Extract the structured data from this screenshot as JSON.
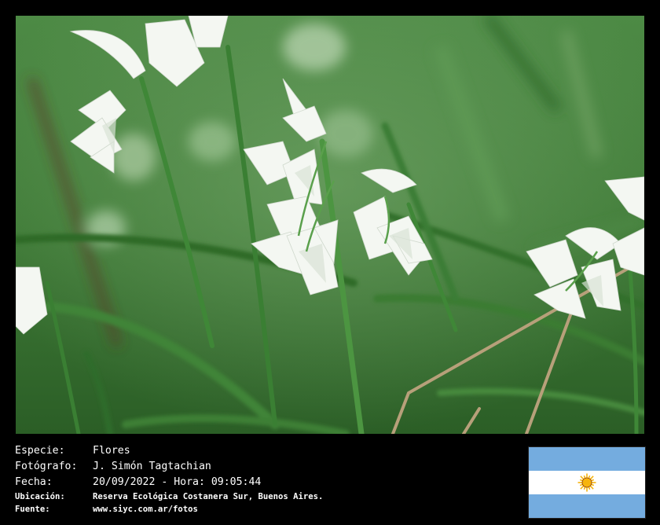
{
  "caption": {
    "especie_label": "Especie:",
    "especie_value": "Flores",
    "fotografo_label": "Fotógrafo:",
    "fotografo_value": "J. Simón Tagtachian",
    "fecha_label": "Fecha:",
    "fecha_value": "20/09/2022 - Hora: 09:05:44",
    "ubicacion_label": "Ubicación:",
    "ubicacion_value": "Reserva Ecológica Costanera Sur, Buenos Aires.",
    "fuente_label": "Fuente:",
    "fuente_value": "www.siyc.com.ar/fotos"
  },
  "flag": {
    "sky_color": "#74acdf",
    "white_color": "#ffffff",
    "sun_color": "#f6b40e",
    "sun_stroke": "#85340a"
  },
  "colors": {
    "background": "#000000",
    "foliage": "#3b7a33"
  }
}
